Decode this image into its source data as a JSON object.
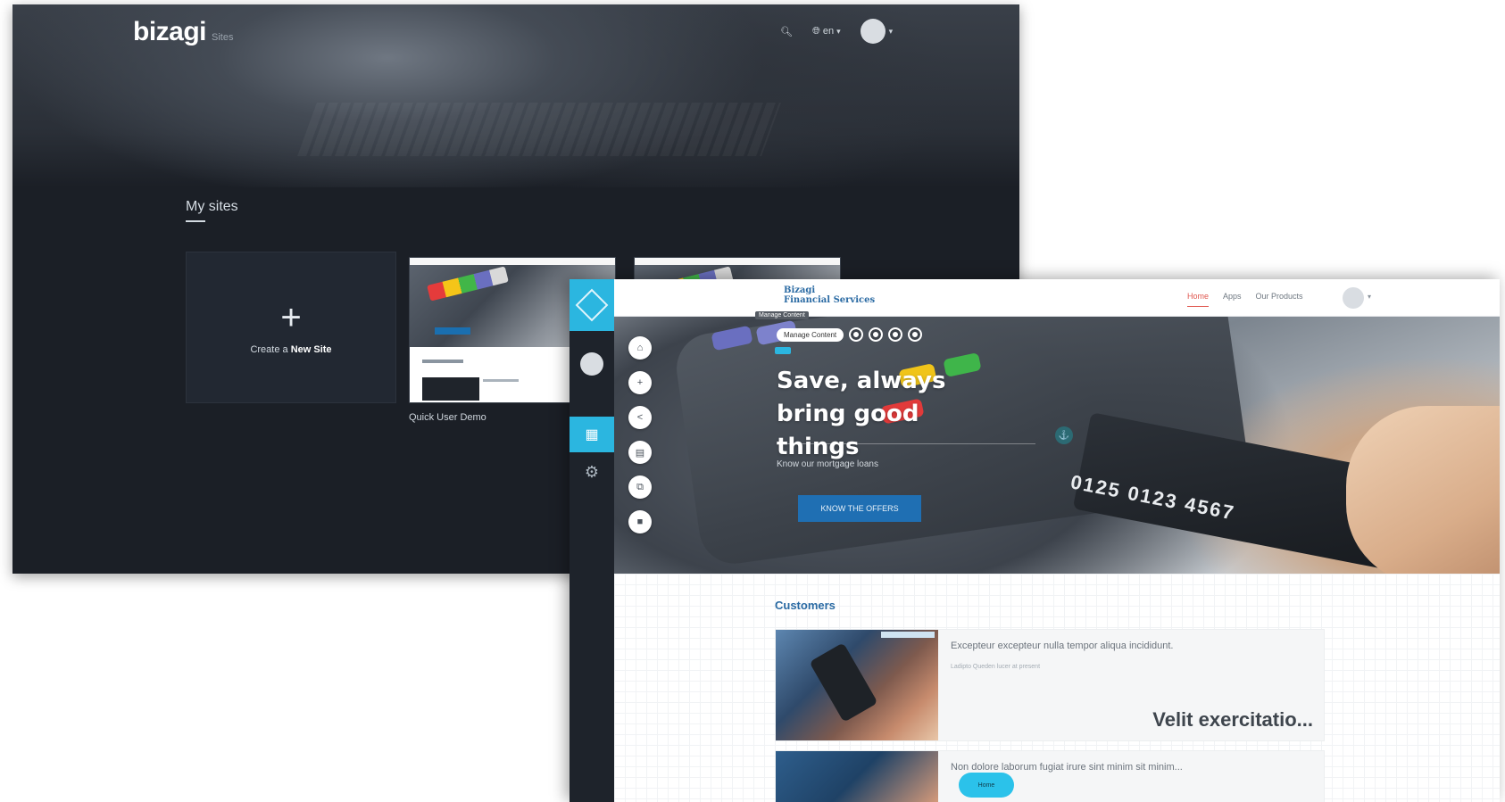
{
  "dashboard": {
    "logo": "bizagi",
    "logo_sub": "Sites",
    "nav": {
      "search_icon": "search-icon",
      "language_label": "en",
      "avatar_icon": "avatar"
    },
    "section_title": "My sites",
    "create_card": {
      "prefix": "Create a ",
      "bold": "New Site"
    },
    "sites": [
      {
        "label": "Quick User Demo"
      },
      {
        "label": ""
      }
    ]
  },
  "editor": {
    "brand_line1": "Bizagi",
    "brand_line2": "Financial Services",
    "brand_tooltip": "Manage Content",
    "menu": [
      "Home",
      "Apps",
      "Our Products"
    ],
    "active_menu": "Home",
    "toolbar": {
      "manage_label": "Manage Content"
    },
    "hero": {
      "title": "Save, always bring good things",
      "subtitle": "Know our mortgage loans",
      "cta": "KNOW THE OFFERS",
      "card_text": "0125 0123 4567"
    },
    "side_tools": [
      "home-icon",
      "add-icon",
      "share-icon",
      "layout-icon",
      "duplicate-icon",
      "delete-icon"
    ],
    "content": {
      "section_title": "Customers",
      "cards": [
        {
          "title": "Excepteur excepteur nulla tempor aliqua incididunt.",
          "meta": "Ladipto Queden lucer at present",
          "big": "Velit exercitatio..."
        },
        {
          "title": "Non dolore laborum fugiat irure sint minim sit minim...",
          "meta": "",
          "big": ""
        }
      ],
      "floating_pill": "Home"
    }
  },
  "colors": {
    "accent": "#2bb6e0",
    "brand": "#2a6aa3",
    "cta": "#1f6fb3",
    "dark": "#1b1f26"
  }
}
